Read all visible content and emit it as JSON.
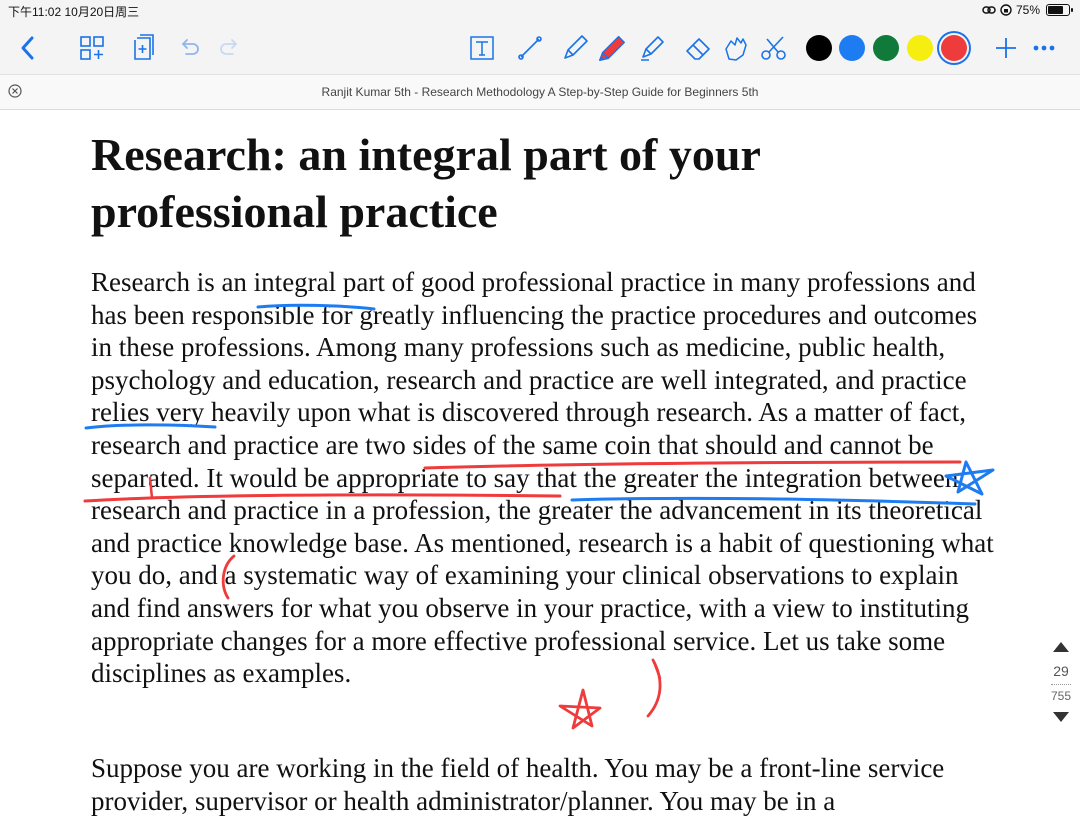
{
  "status_bar": {
    "time_date": "下午11:02   10月20日周三",
    "battery": "75%"
  },
  "toolbar": {
    "back_icon": "chevron-left-icon",
    "colors": [
      "#000000",
      "#1e7cf2",
      "#0f7a3a",
      "#f5ee10",
      "#ee3b3b"
    ],
    "selected_color": "#ee3b3b"
  },
  "document": {
    "title": "Ranjit Kumar 5th - Research Methodology A Step-by-Step Guide for Beginners 5th"
  },
  "content": {
    "heading": "Research: an integral part of your professional practice",
    "paragraph1": "Research is an integral part of good professional practice in many professions and has been responsible for greatly influencing the practice procedures and outcomes in these professions. Among many professions such as medicine, public health, psychology and education, research and practice are well integrated, and practice relies very heavily upon what is discovered through research. As a matter of fact, research and practice are two sides of the same coin that should and cannot be separated. It would be appropriate to say that the greater the integration between research and practice in a profession, the greater the advancement in its theoretical and practice knowledge base. As mentioned, research is a habit of questioning what you do, and a systematic way of examining your clinical observations to explain and find answers for what you observe in your practice, with a view to instituting appropriate changes for a more effective professional service. Let us take some disciplines as examples.",
    "paragraph2": "Suppose you are working in the field of health. You may be a front-line service provider, supervisor or health administrator/planner. You may be in a"
  },
  "page_nav": {
    "current": "29",
    "total": "755"
  }
}
